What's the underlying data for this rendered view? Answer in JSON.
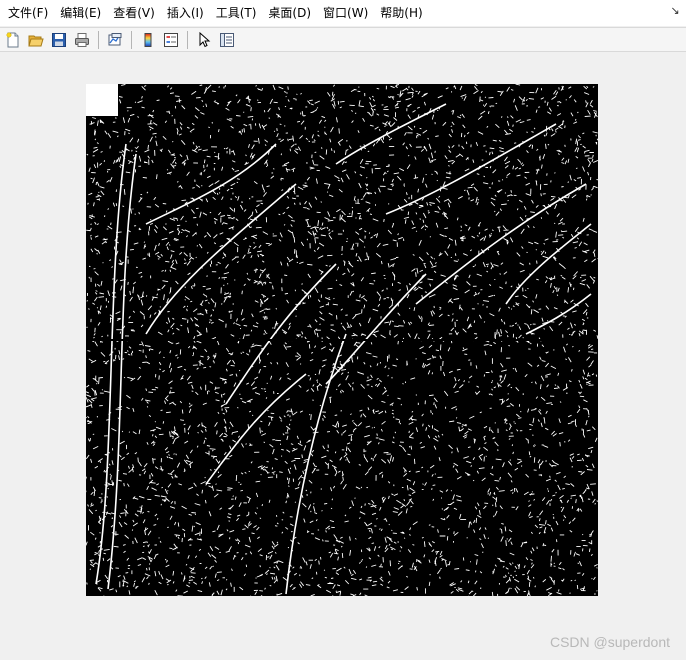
{
  "menubar": {
    "items": [
      {
        "label": "文件(F)"
      },
      {
        "label": "编辑(E)"
      },
      {
        "label": "查看(V)"
      },
      {
        "label": "插入(I)"
      },
      {
        "label": "工具(T)"
      },
      {
        "label": "桌面(D)"
      },
      {
        "label": "窗口(W)"
      },
      {
        "label": "帮助(H)"
      }
    ],
    "dock_icon": "↘"
  },
  "toolbar": {
    "buttons": [
      {
        "icon": "new-figure-icon"
      },
      {
        "icon": "open-file-icon"
      },
      {
        "icon": "save-icon"
      },
      {
        "icon": "print-icon"
      },
      {
        "icon": "link-plot-icon"
      },
      {
        "icon": "colorbar-icon"
      },
      {
        "icon": "legend-icon"
      },
      {
        "icon": "edit-plot-pointer-icon"
      },
      {
        "icon": "property-inspector-icon"
      }
    ]
  },
  "figure": {
    "image_description_colors": {
      "background": "#000000",
      "foreground": "#ffffff"
    }
  },
  "watermark": {
    "text": "CSDN @superdont"
  }
}
